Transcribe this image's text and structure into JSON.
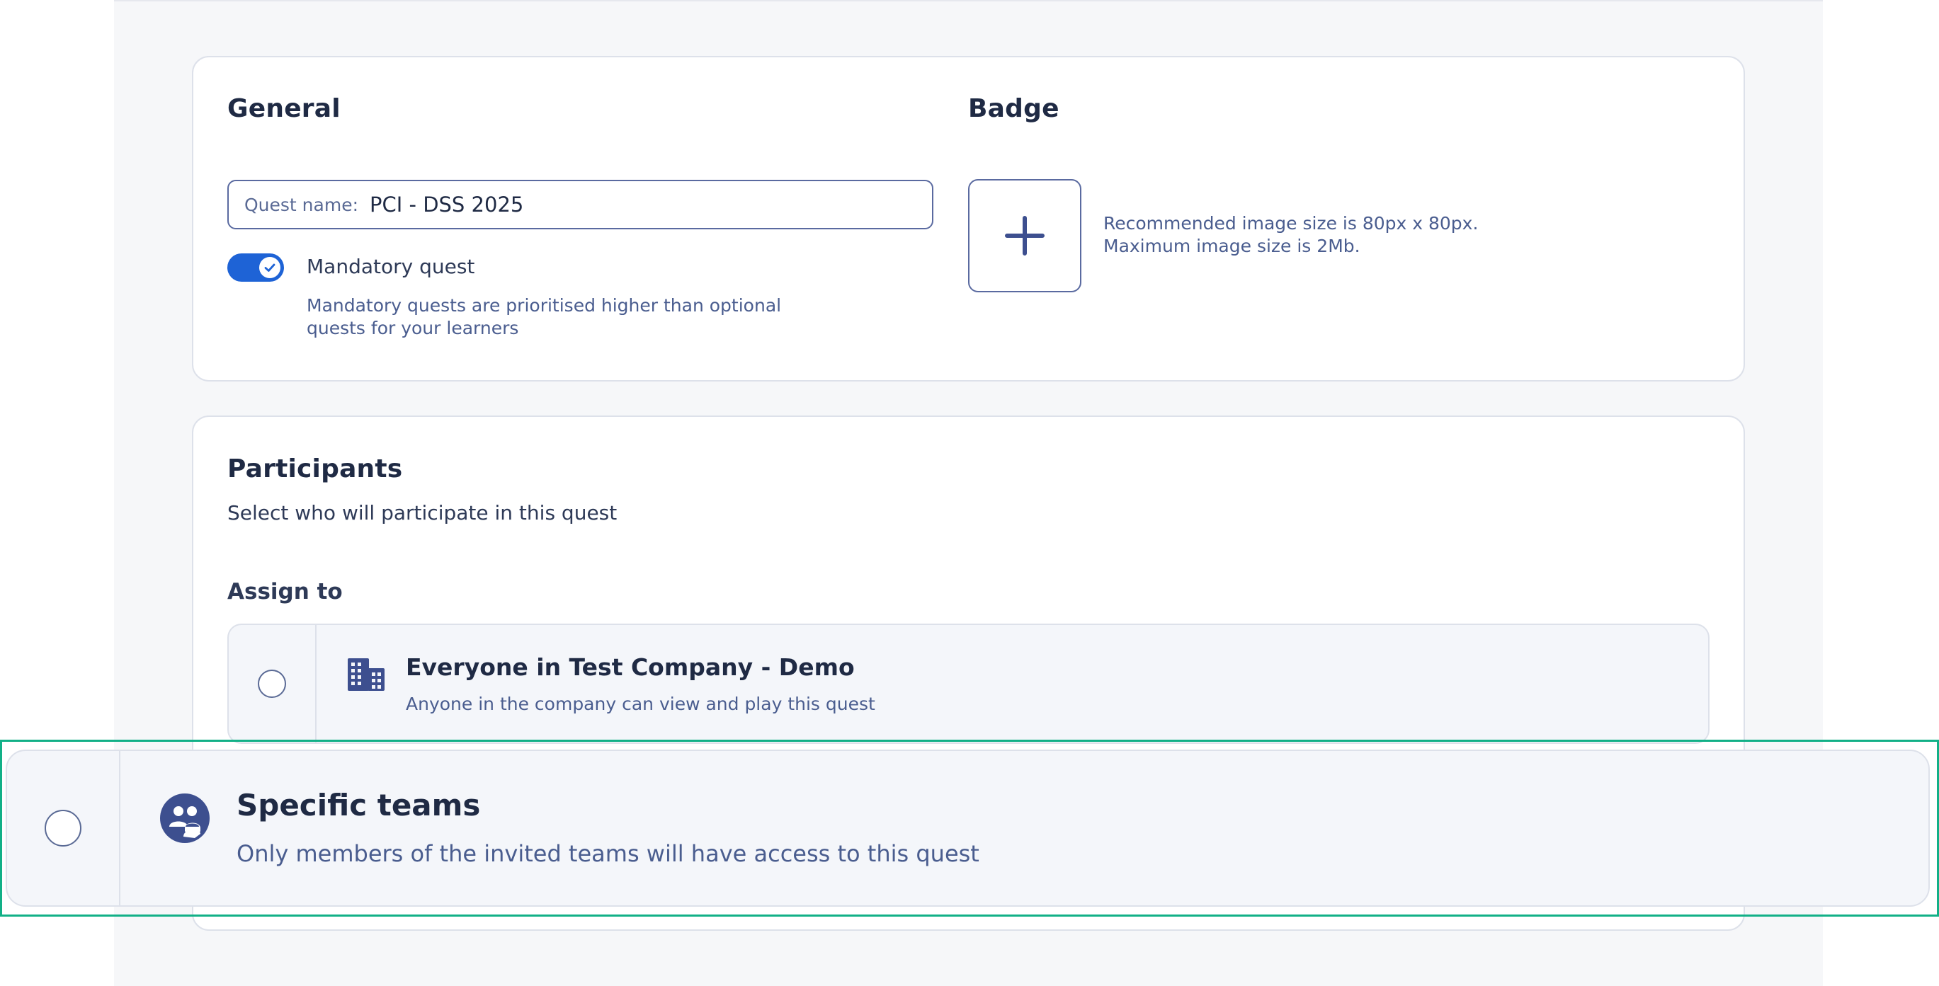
{
  "general": {
    "title": "General",
    "quest_name_label": "Quest name:",
    "quest_name_value": "PCI - DSS 2025",
    "mandatory": {
      "label": "Mandatory quest",
      "enabled": true,
      "description_line1": "Mandatory quests are prioritised higher than optional",
      "description_line2": "quests for your learners"
    }
  },
  "badge": {
    "title": "Badge",
    "add_icon": "plus-icon",
    "hint_line1": "Recommended image size is 80px x 80px.",
    "hint_line2": "Maximum image size is 2Mb."
  },
  "participants": {
    "title": "Participants",
    "subtitle": "Select who will participate in this quest",
    "assign_to_label": "Assign to",
    "options": [
      {
        "icon": "building-icon",
        "title": "Everyone in Test Company - Demo",
        "description": "Anyone in the company can view and play this quest",
        "selected": false
      },
      {
        "icon": "teams-icon",
        "title": "Specific teams",
        "description": "Only members of the invited teams will have access to this quest",
        "selected": false
      }
    ]
  },
  "colors": {
    "accent": "#1e63d6",
    "highlight": "#12b087",
    "icon": "#3d4f8f"
  }
}
